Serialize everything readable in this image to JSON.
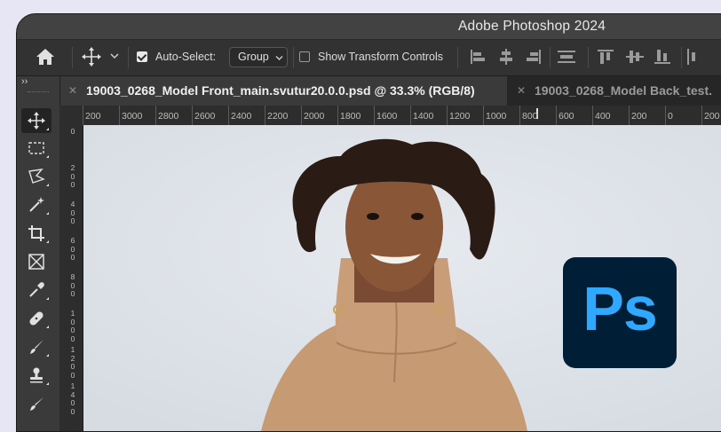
{
  "app": {
    "title": "Adobe Photoshop 2024"
  },
  "options_bar": {
    "auto_select_label": "Auto-Select:",
    "auto_select_checked": true,
    "auto_select_value": "Group",
    "transform_label": "Show Transform Controls",
    "transform_checked": false
  },
  "tabs": [
    {
      "label": "19003_0268_Model Front_main.svutur20.0.0.psd @ 33.3% (RGB/8)",
      "active": true
    },
    {
      "label": "19003_0268_Model Back_test.",
      "active": false
    }
  ],
  "toolbar": {
    "collapse": "››"
  },
  "ruler": {
    "top_ticks": [
      "200",
      "3000",
      "2800",
      "2600",
      "2400",
      "2200",
      "2000",
      "1800",
      "1600",
      "1400",
      "1200",
      "1000",
      "800",
      "600",
      "400",
      "200",
      "0",
      "200"
    ],
    "left_ticks": [
      [
        "0"
      ],
      [
        "2",
        "0",
        "0"
      ],
      [
        "4",
        "0",
        "0"
      ],
      [
        "6",
        "0",
        "0"
      ],
      [
        "8",
        "0",
        "0"
      ],
      [
        "1",
        "0",
        "0",
        "0"
      ],
      [
        "1",
        "2",
        "0",
        "0"
      ],
      [
        "1",
        "4",
        "0",
        "0"
      ]
    ]
  },
  "logo": {
    "text": "Ps",
    "bg": "#001e36",
    "fg": "#31a8ff"
  },
  "colors": {
    "chrome": "#323232",
    "canvas": "#e1e5ea",
    "page_bg": "#e6e6f5"
  }
}
